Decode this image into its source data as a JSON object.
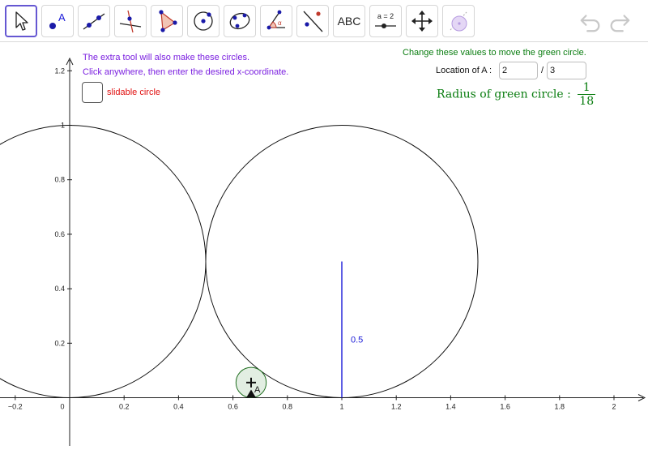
{
  "toolbar": {
    "tools": [
      {
        "name": "move-tool",
        "active": true
      },
      {
        "name": "point-tool",
        "label": "A"
      },
      {
        "name": "line-tool"
      },
      {
        "name": "perpendicular-line-tool"
      },
      {
        "name": "polygon-tool"
      },
      {
        "name": "circle-center-point-tool"
      },
      {
        "name": "conic-tool"
      },
      {
        "name": "angle-tool",
        "label": "α"
      },
      {
        "name": "reflect-tool"
      },
      {
        "name": "text-tool",
        "label": "ABC"
      },
      {
        "name": "slider-tool",
        "label": "a = 2"
      },
      {
        "name": "move-graphics-view-tool"
      },
      {
        "name": "custom-circle-tool"
      }
    ],
    "undo_icon": "undo-icon",
    "redo_icon": "redo-icon"
  },
  "instructions": {
    "line1": "The extra tool will also make these circles.",
    "line2": "Click anywhere, then enter the desired x-coordinate."
  },
  "checkbox": {
    "label": "slidable circle",
    "checked": false
  },
  "controls": {
    "heading": "Change these values to move the green circle.",
    "location_label": "Location of A :",
    "numerator": "2",
    "slash": "/",
    "denominator": "3",
    "radius_label": "Radius of green circle :",
    "radius_num": "1",
    "radius_den": "18"
  },
  "graph": {
    "x_ticks": [
      "−0.2",
      "0",
      "0.2",
      "0.4",
      "0.6",
      "0.8",
      "1",
      "1.2",
      "1.4",
      "1.6",
      "1.8",
      "2"
    ],
    "y_ticks": [
      "0.2",
      "0.4",
      "0.6",
      "0.8",
      "1",
      "1.2"
    ],
    "segment_label": "0.5",
    "point_label": "A",
    "circle_left": {
      "center_x": 0,
      "center_y": 0.5,
      "radius": 0.5
    },
    "circle_right": {
      "center_x": 1,
      "center_y": 0.5,
      "radius": 0.5
    },
    "circle_green": {
      "center_x": 0.6667,
      "center_y": 0.0556,
      "radius": 0.0556
    },
    "point_A": {
      "x": 0.6667,
      "y": 0.0556
    },
    "segment": {
      "x": 1,
      "y_start": 0,
      "y_end": 0.5
    },
    "colors": {
      "accent": "#6557d2",
      "purple_text": "#7a1ee0",
      "green_text": "#0a7d10",
      "green_fill": "#e2eee2",
      "segment_blue": "#1a1ad8",
      "checkbox_label": "#e01010"
    }
  }
}
